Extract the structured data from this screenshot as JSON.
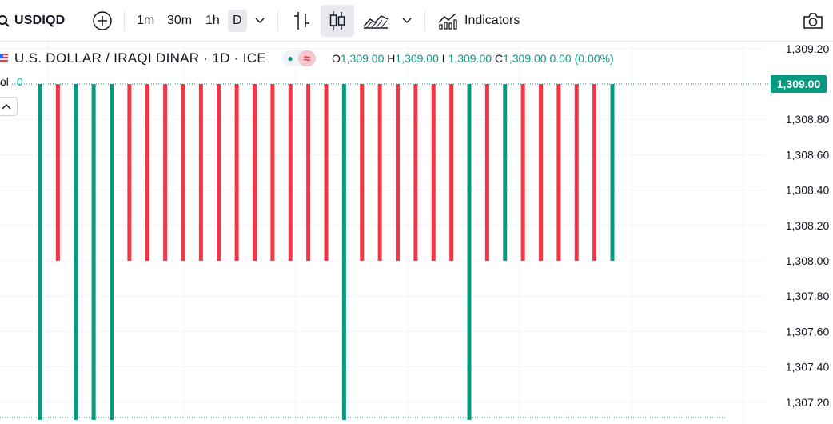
{
  "toolbar": {
    "symbol": "USDIQD",
    "intervals": [
      "1m",
      "30m",
      "1h",
      "D"
    ],
    "active_interval": "D",
    "indicators_label": "Indicators"
  },
  "legend": {
    "title": "U.S. DOLLAR / IRAQI DINAR · 1D · ICE",
    "status_wave": "≈",
    "open_key": "O",
    "open": "1,309.00",
    "high_key": "H",
    "high": "1,309.00",
    "low_key": "L",
    "low": "1,309.00",
    "close_key": "C",
    "close": "1,309.00",
    "change": "0.00 (0.00%)"
  },
  "volume": {
    "label": "ol",
    "value": "0"
  },
  "colors": {
    "up": "#089981",
    "down": "#f23645",
    "grid": "#f0f3fa",
    "badge": "#089981"
  },
  "icons": [
    "search-icon",
    "add-symbol-icon",
    "chevron-down-icon",
    "bar-chart-icon",
    "candles-icon",
    "area-chart-icon",
    "indicators-icon",
    "camera-icon",
    "flag-icon",
    "chevron-up-icon"
  ],
  "chart_data": {
    "type": "candlestick",
    "ylim": [
      1307.1,
      1309.3
    ],
    "y_ticks": [
      "1,309.20",
      "1,308.80",
      "1,308.60",
      "1,308.40",
      "1,308.20",
      "1,308.00",
      "1,307.80",
      "1,307.60",
      "1,307.40",
      "1,307.20"
    ],
    "last_price": "1,309.00",
    "candles": [
      {
        "o": 1307.1,
        "c": 1309.0,
        "d": "up"
      },
      {
        "o": 1309.0,
        "c": 1308.0,
        "d": "down"
      },
      {
        "o": 1307.1,
        "c": 1309.0,
        "d": "up"
      },
      {
        "o": 1307.1,
        "c": 1309.0,
        "d": "up"
      },
      {
        "o": 1307.1,
        "c": 1309.0,
        "d": "up"
      },
      {
        "o": 1309.0,
        "c": 1308.0,
        "d": "down"
      },
      {
        "o": 1309.0,
        "c": 1308.0,
        "d": "down"
      },
      {
        "o": 1309.0,
        "c": 1308.0,
        "d": "down"
      },
      {
        "o": 1309.0,
        "c": 1308.0,
        "d": "down"
      },
      {
        "o": 1309.0,
        "c": 1308.0,
        "d": "down"
      },
      {
        "o": 1309.0,
        "c": 1308.0,
        "d": "down"
      },
      {
        "o": 1309.0,
        "c": 1308.0,
        "d": "down"
      },
      {
        "o": 1309.0,
        "c": 1308.0,
        "d": "down"
      },
      {
        "o": 1309.0,
        "c": 1308.0,
        "d": "down"
      },
      {
        "o": 1309.0,
        "c": 1308.0,
        "d": "down"
      },
      {
        "o": 1309.0,
        "c": 1308.0,
        "d": "down"
      },
      {
        "o": 1309.0,
        "c": 1308.0,
        "d": "down"
      },
      {
        "o": 1307.1,
        "c": 1309.0,
        "d": "up"
      },
      {
        "o": 1309.0,
        "c": 1308.0,
        "d": "down"
      },
      {
        "o": 1309.0,
        "c": 1308.0,
        "d": "down"
      },
      {
        "o": 1309.0,
        "c": 1308.0,
        "d": "down"
      },
      {
        "o": 1309.0,
        "c": 1308.0,
        "d": "down"
      },
      {
        "o": 1309.0,
        "c": 1308.0,
        "d": "down"
      },
      {
        "o": 1309.0,
        "c": 1308.0,
        "d": "down"
      },
      {
        "o": 1307.1,
        "c": 1309.0,
        "d": "up"
      },
      {
        "o": 1309.0,
        "c": 1308.0,
        "d": "down"
      },
      {
        "o": 1308.0,
        "c": 1309.0,
        "d": "up"
      },
      {
        "o": 1309.0,
        "c": 1308.0,
        "d": "down"
      },
      {
        "o": 1309.0,
        "c": 1308.0,
        "d": "down"
      },
      {
        "o": 1309.0,
        "c": 1308.0,
        "d": "down"
      },
      {
        "o": 1309.0,
        "c": 1308.0,
        "d": "down"
      },
      {
        "o": 1309.0,
        "c": 1308.0,
        "d": "down"
      },
      {
        "o": 1308.0,
        "c": 1309.0,
        "d": "up"
      }
    ]
  }
}
